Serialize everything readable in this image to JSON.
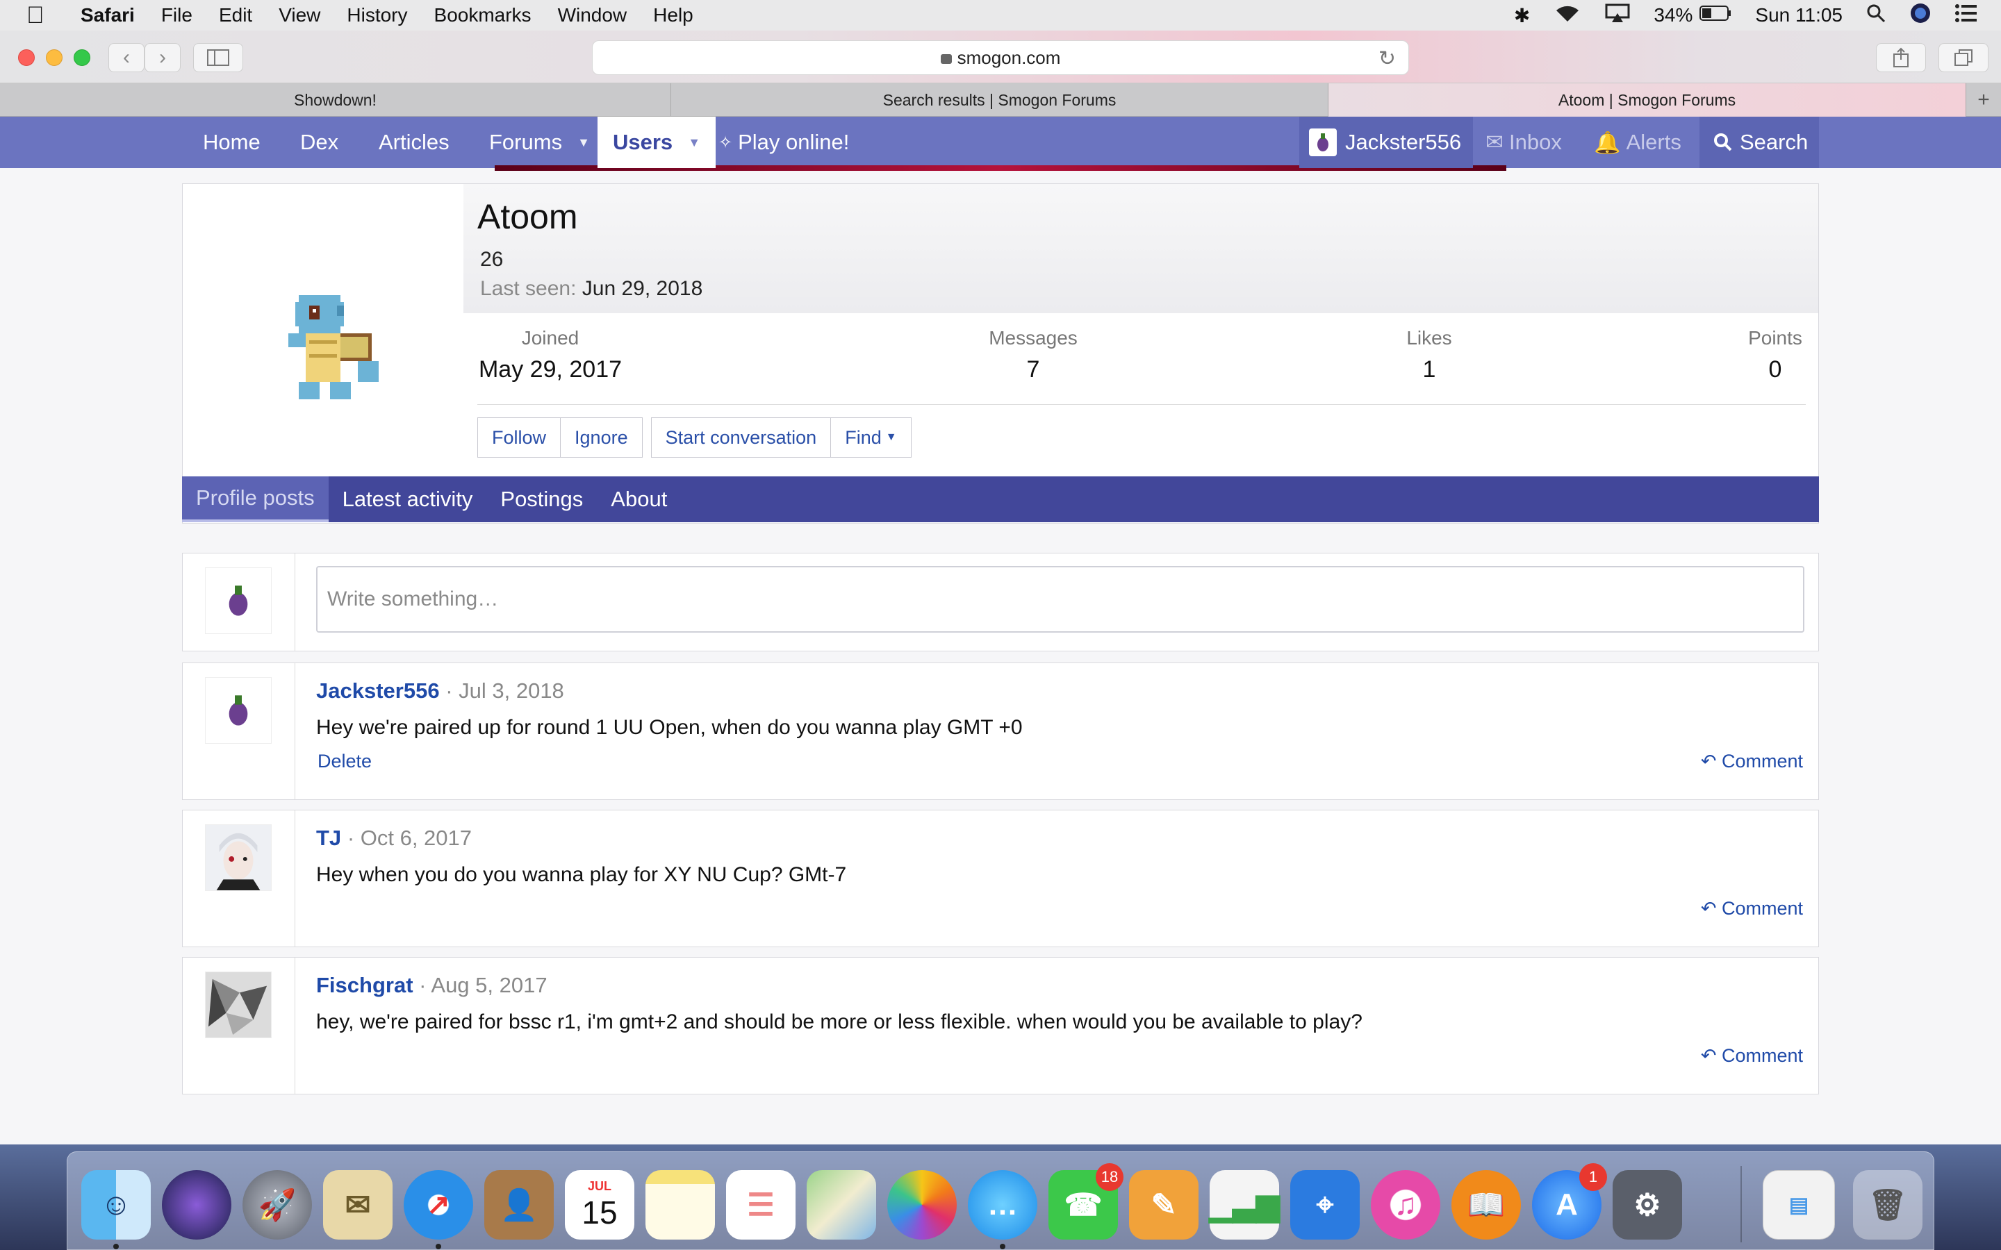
{
  "menubar": {
    "app": "Safari",
    "items": [
      "File",
      "Edit",
      "View",
      "History",
      "Bookmarks",
      "Window",
      "Help"
    ],
    "battery": "34%",
    "clock": "Sun 11:05"
  },
  "browser": {
    "url": "smogon.com",
    "tabs": [
      "Showdown!",
      "Search results | Smogon Forums",
      "Atoom | Smogon Forums"
    ],
    "active_tab": 2
  },
  "sitenav": {
    "items": [
      "Home",
      "Dex",
      "Articles",
      "Forums",
      "Users",
      "Play online!"
    ],
    "user": "Jackster556",
    "inbox": "Inbox",
    "alerts": "Alerts",
    "search": "Search"
  },
  "profile": {
    "name": "Atoom",
    "title": "26",
    "last_seen_label": "Last seen:",
    "last_seen": "Jun 29, 2018",
    "stats": [
      {
        "label": "Joined",
        "value": "May 29, 2017"
      },
      {
        "label": "Messages",
        "value": "7"
      },
      {
        "label": "Likes",
        "value": "1"
      },
      {
        "label": "Points",
        "value": "0"
      }
    ],
    "buttons": [
      "Follow",
      "Ignore",
      "Start conversation",
      "Find"
    ]
  },
  "profile_tabs": [
    "Profile posts",
    "Latest activity",
    "Postings",
    "About"
  ],
  "composer": {
    "placeholder": "Write something…"
  },
  "posts": [
    {
      "author": "Jackster556",
      "date": "Jul 3, 2018",
      "text": "Hey we're paired up for round 1 UU Open, when do you wanna play GMT +0",
      "delete": "Delete",
      "comment": "Comment"
    },
    {
      "author": "TJ",
      "date": "Oct 6, 2017",
      "text": "Hey when you do you wanna play for XY NU Cup? GMt-7",
      "comment": "Comment"
    },
    {
      "author": "Fischgrat",
      "date": "Aug 5, 2017",
      "text": "hey, we're paired for bssc r1, i'm gmt+2 and should be more or less flexible. when would you be available to play?",
      "comment": "Comment"
    }
  ],
  "dock": {
    "apps": [
      "finder-icon",
      "siri-icon",
      "launchpad-icon",
      "mail-icon",
      "safari-icon",
      "contacts-icon",
      "calendar-icon",
      "notes-icon",
      "reminders-icon",
      "maps-icon",
      "photos-icon",
      "messages-icon",
      "facetime-icon",
      "pages-icon",
      "numbers-icon",
      "keynote-icon",
      "itunes-icon",
      "ibooks-icon",
      "app-store-icon",
      "system-preferences-icon"
    ],
    "calendar_month": "JUL",
    "calendar_day": "15",
    "facetime_badge": "18",
    "appstore_badge": "1"
  },
  "colors": {
    "nav": "#6b74c0",
    "tabs": "#42479a",
    "link": "#1f4aa8"
  }
}
